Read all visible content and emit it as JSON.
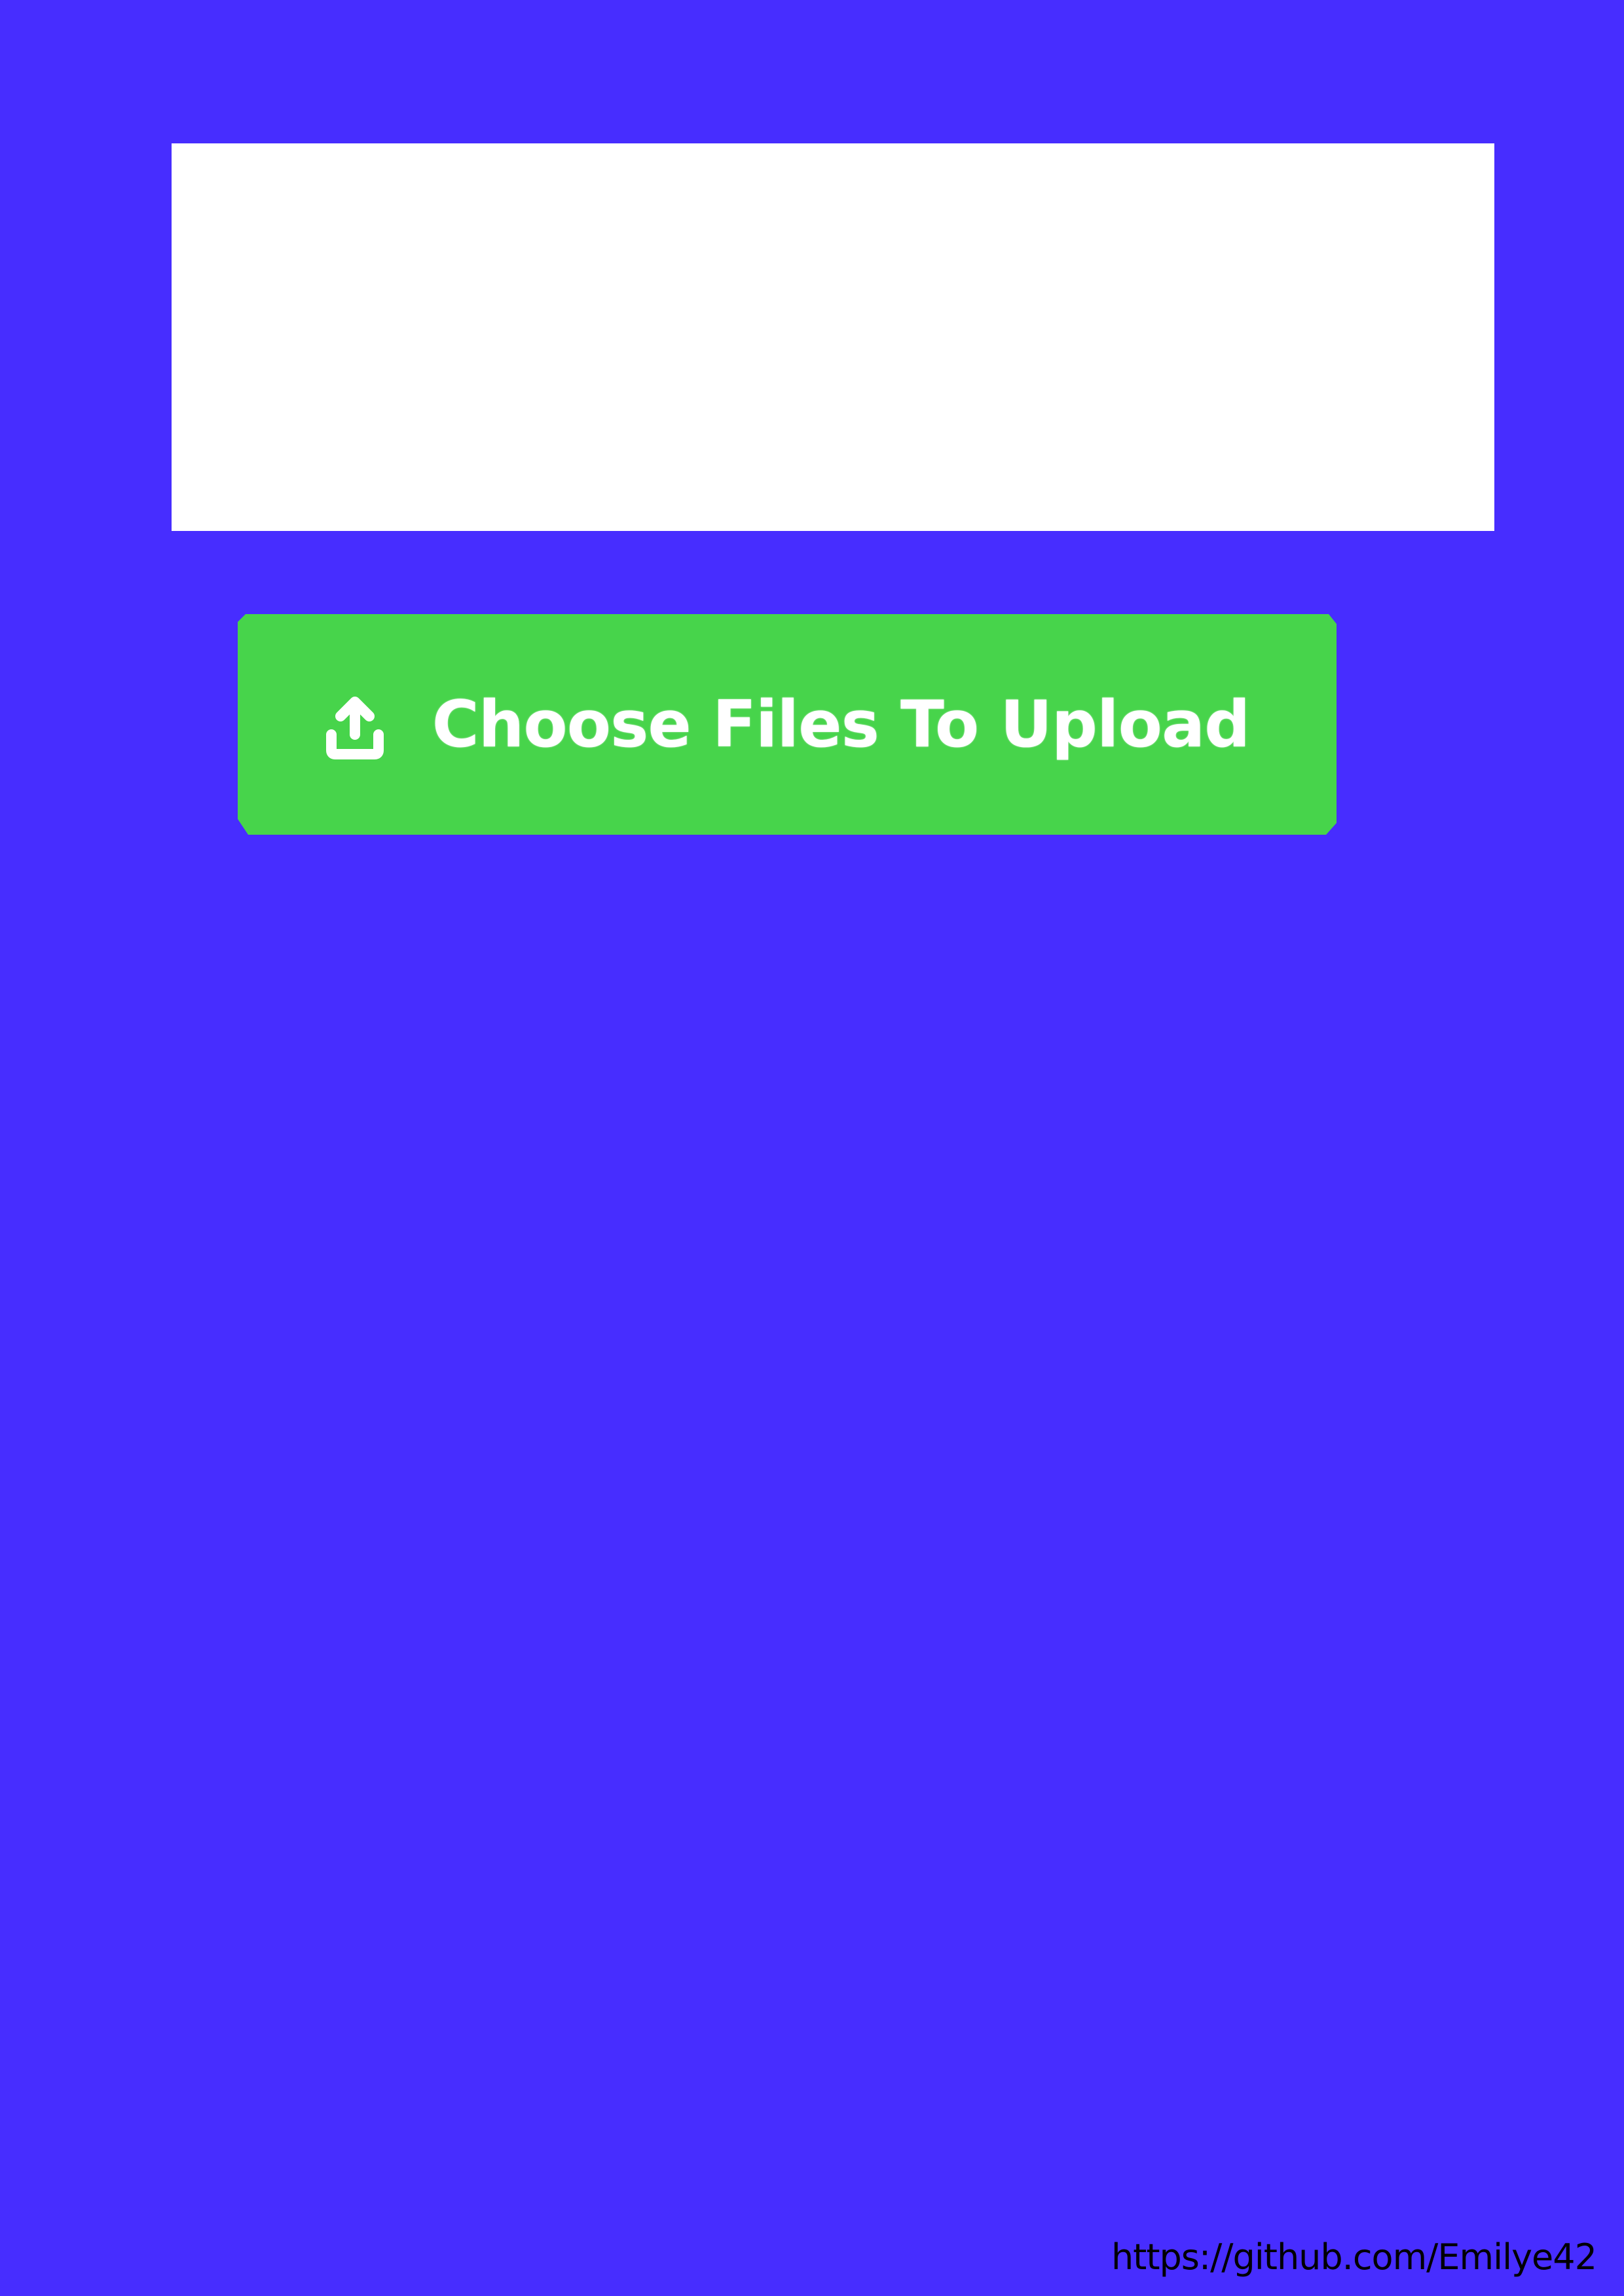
{
  "upload": {
    "button_label": "Choose Files To Upload",
    "icon": "upload-icon"
  },
  "footer": {
    "credit": "https://github.com/Emilye42"
  },
  "colors": {
    "background": "#472dff",
    "preview": "#ffffff",
    "button": "#47d44b",
    "button_text": "#ffffff"
  }
}
